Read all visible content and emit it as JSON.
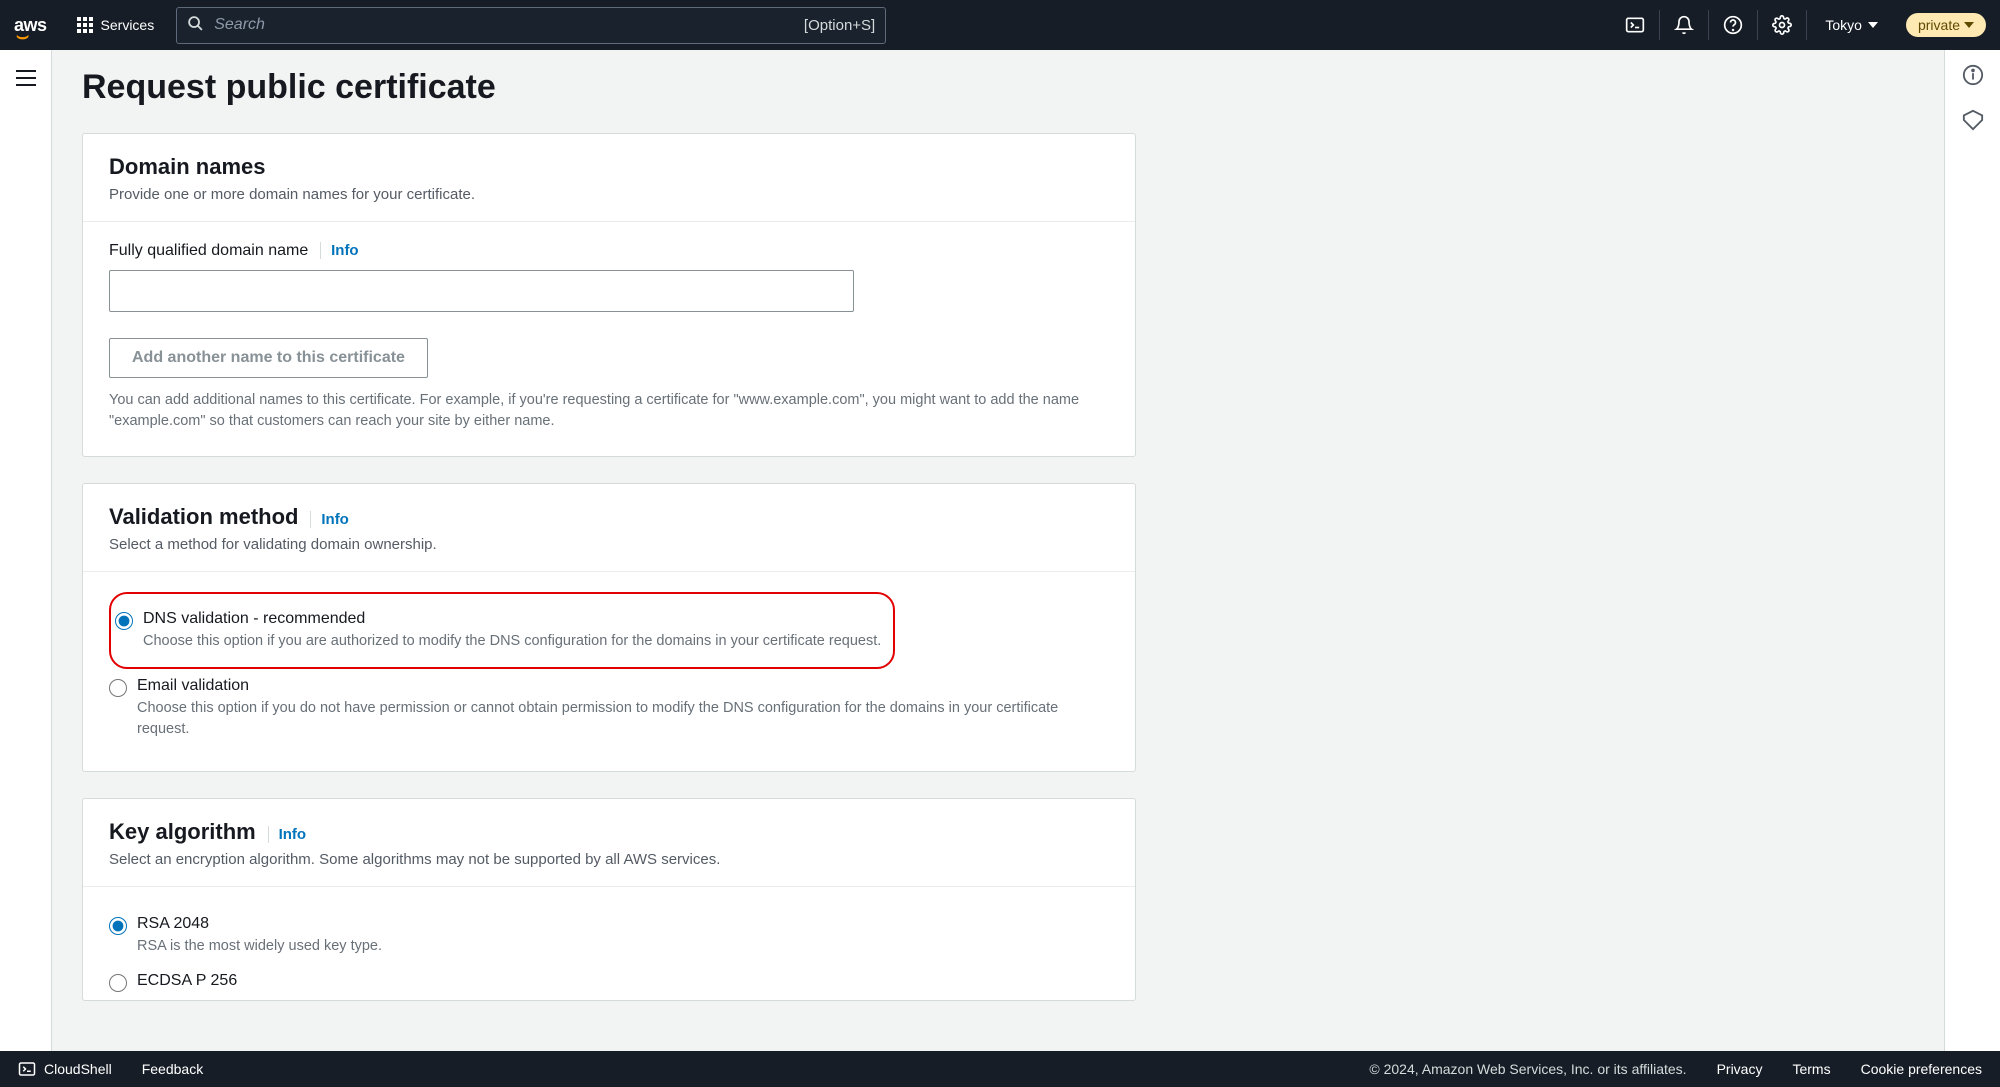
{
  "nav": {
    "logo": "aws",
    "services_label": "Services",
    "search_placeholder": "Search",
    "search_shortcut": "[Option+S]",
    "region": "Tokyo",
    "account_badge": "private"
  },
  "page": {
    "title": "Request public certificate"
  },
  "domain_panel": {
    "heading": "Domain names",
    "sub": "Provide one or more domain names for your certificate.",
    "field_label": "Fully qualified domain name",
    "info": "Info",
    "add_button": "Add another name to this certificate",
    "hint": "You can add additional names to this certificate. For example, if you're requesting a certificate for \"www.example.com\", you might want to add the name \"example.com\" so that customers can reach your site by either name."
  },
  "validation_panel": {
    "heading": "Validation method",
    "info": "Info",
    "sub": "Select a method for validating domain ownership.",
    "options": [
      {
        "title": "DNS validation - recommended",
        "desc": "Choose this option if you are authorized to modify the DNS configuration for the domains in your certificate request.",
        "checked": true,
        "highlight": true
      },
      {
        "title": "Email validation",
        "desc": "Choose this option if you do not have permission or cannot obtain permission to modify the DNS configuration for the domains in your certificate request.",
        "checked": false,
        "highlight": false
      }
    ]
  },
  "key_panel": {
    "heading": "Key algorithm",
    "info": "Info",
    "sub": "Select an encryption algorithm. Some algorithms may not be supported by all AWS services.",
    "options": [
      {
        "title": "RSA 2048",
        "desc": "RSA is the most widely used key type.",
        "checked": true
      },
      {
        "title": "ECDSA P 256",
        "desc": "",
        "checked": false
      }
    ]
  },
  "footer": {
    "cloudshell": "CloudShell",
    "feedback": "Feedback",
    "copyright": "© 2024, Amazon Web Services, Inc. or its affiliates.",
    "links": [
      "Privacy",
      "Terms",
      "Cookie preferences"
    ]
  }
}
